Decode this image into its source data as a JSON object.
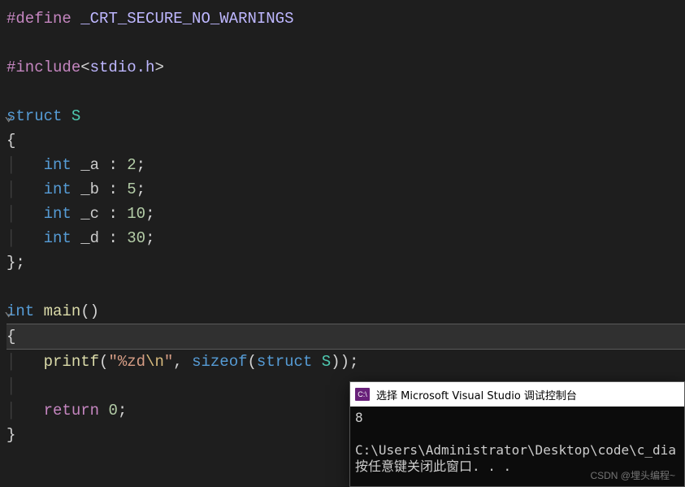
{
  "code": {
    "line1_directive": "#define",
    "line1_macro": "_CRT_SECURE_NO_WARNINGS",
    "line2_directive": "#include",
    "line2_open": "<",
    "line2_header": "stdio.h",
    "line2_close": ">",
    "struct_kw": "struct",
    "struct_name": "S",
    "open_brace": "{",
    "close_brace": "}",
    "close_brace_semi": "};",
    "int_kw": "int",
    "field_a": "_a",
    "field_a_bits": "2",
    "field_b": "_b",
    "field_b_bits": "5",
    "field_c": "_c",
    "field_c_bits": "10",
    "field_d": "_d",
    "field_d_bits": "30",
    "colon": " : ",
    "semi": ";",
    "main_name": "main",
    "paren_open": "(",
    "paren_close": ")",
    "printf_name": "printf",
    "printf_str_open": "\"",
    "printf_fmt": "%zd",
    "printf_esc": "\\n",
    "printf_str_close": "\"",
    "comma": ", ",
    "sizeof_kw": "sizeof",
    "return_kw": "return",
    "return_val": "0"
  },
  "console": {
    "icon_text": "C:\\",
    "title": "选择 Microsoft Visual Studio 调试控制台",
    "output_line1": "8",
    "output_line2": "",
    "output_line3": "C:\\Users\\Administrator\\Desktop\\code\\c_dia",
    "output_line4": "按任意键关闭此窗口. . ."
  },
  "watermark": "CSDN @埋头编程~"
}
